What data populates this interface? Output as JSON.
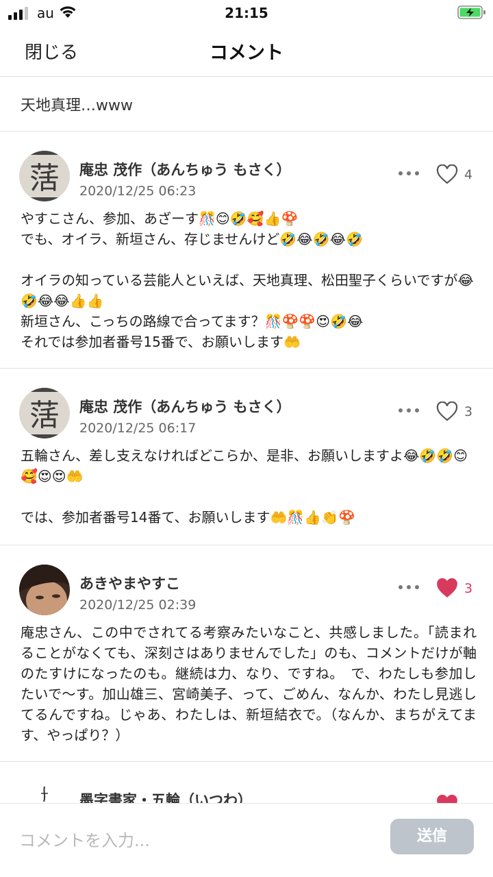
{
  "status_bar": {
    "carrier": "au",
    "time": "21:15",
    "battery_color": "#4cd964"
  },
  "nav": {
    "close_label": "閉じる",
    "title": "コメント"
  },
  "post": {
    "text": "天地真理…www"
  },
  "comments": [
    {
      "author": "庵忠 茂作（あんちゅう もさく）",
      "date": "2020/12/25 06:23",
      "likes": "4",
      "liked": false,
      "avatar_glyph": "萿",
      "body": "やすこさん、参加、あざーす🎊😊🤣🥰👍🍄\nでも、オイラ、新垣さん、存じませんけど🤣😂🤣😂🤣\n\nオイラの知っている芸能人といえば、天地真理、松田聖子くらいですが😂🤣😂😂👍👍\n新垣さん、こっちの路線で合ってます？🎊🍄🍄😍🤣😂\nそれでは参加者番号15番で、お願いします🤲"
    },
    {
      "author": "庵忠 茂作（あんちゅう もさく）",
      "date": "2020/12/25 06:17",
      "likes": "3",
      "liked": false,
      "avatar_glyph": "萿",
      "body": "五輪さん、差し支えなければどこらか、是非、お願いしますよ😂🤣🤣😊🥰😍😍🤲\n\nでは、参加者番号14番て、お願いします🤲🎊👍👏🍄"
    },
    {
      "author": "あきやまやすこ",
      "date": "2020/12/25 02:39",
      "likes": "3",
      "liked": true,
      "avatar_glyph": "",
      "body": "庵忠さん、この中でされてる考察みたいなこと、共感しました。「読まれることがなくても、深刻さはありませんでした」のも、コメントだけが軸のたすけになったのも。継続は力、なり、ですね。　で、わたしも参加したいで〜す。加山雄三、宮崎美子、って、ごめん、なんか、わたし見逃してるんですね。じゃあ、わたしは、新垣結衣で。（なんか、まちがえてます、やっぱり？）"
    },
    {
      "author": "墨字書家・五輪（いつわ）",
      "date": "",
      "likes": "",
      "liked": true,
      "avatar_glyph": "",
      "body": ""
    }
  ],
  "composer": {
    "placeholder": "コメントを入力...",
    "send_label": "送信"
  },
  "colors": {
    "accent_like": "#d83a5e",
    "send_disabled": "#bdc4cb"
  }
}
